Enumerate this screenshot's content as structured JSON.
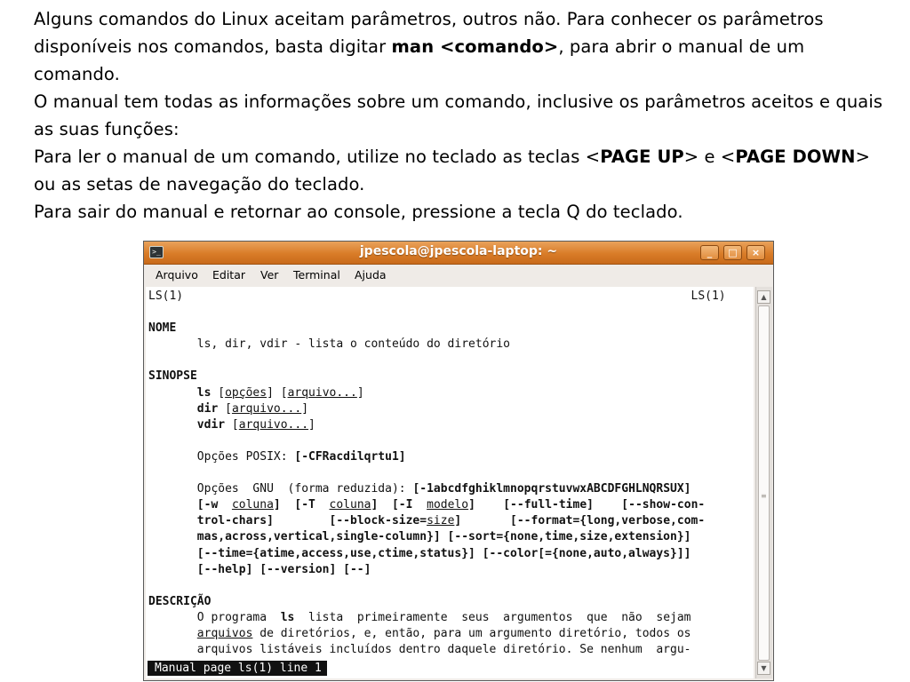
{
  "intro": {
    "p1_a": "Alguns comandos do Linux aceitam parâmetros, outros não. Para conhecer os parâmetros disponíveis nos comandos, basta digitar ",
    "p1_b": "man <comando>",
    "p1_c": ", para abrir o manual de um comando.",
    "p2": "O manual tem todas as informações sobre um comando, inclusive os parâmetros aceitos e quais as suas funções:",
    "p3_a": "Para ler o manual de um comando, utilize no teclado as teclas <",
    "p3_b": "PAGE UP",
    "p3_c": "> e <",
    "p3_d": "PAGE DOWN",
    "p3_e": "> ou as setas de navegação do teclado.",
    "p4": "Para sair do manual e retornar ao console, pressione a tecla Q do teclado."
  },
  "window": {
    "title": "jpescola@jpescola-laptop: ~",
    "terminal_icon": "terminal-icon",
    "minimize_glyph": "_",
    "maximize_glyph": "□",
    "close_glyph": "×",
    "accent_color": "#d97c28"
  },
  "menu": {
    "items": [
      "Arquivo",
      "Editar",
      "Ver",
      "Terminal",
      "Ajuda"
    ]
  },
  "terminal": {
    "header_left": "LS(1)",
    "header_right": "LS(1)",
    "sec_nome": "NOME",
    "nome_text": "ls, dir, vdir - lista o conteúdo do diretório",
    "sec_sinopse": "SINOPSE",
    "syn_ls_cmd": "ls",
    "syn_opcoes": "opções",
    "syn_arquivo": "arquivo...",
    "syn_dir_cmd": "dir",
    "syn_vdir_cmd": "vdir",
    "posix_label": "Opções POSIX: ",
    "posix_opts": "[-CFRacdilqrtu1]",
    "gnu_label": "Opções  GNU  (forma reduzida): ",
    "gnu_line1": "[-1abcdfghiklmnopqrstuvwxABCDFGHLNQRSUX]",
    "w_opt": "[-w  ",
    "coluna": "coluna",
    "t_opt": "[-T  ",
    "i_opt": "[-I  ",
    "modelo": "modelo",
    "full_time": "[--full-time]",
    "show_con": "[--show-con-",
    "trol_chars": "trol-chars]",
    "block_size": "[--block-size=",
    "size_word": "size",
    "format_opt": "[--format={long,verbose,com-",
    "gnu_line4": "mas,across,vertical,single-column}] [--sort={none,time,size,extension}]",
    "gnu_line5": "[--time={atime,access,use,ctime,status}] [--color[={none,auto,always}]]",
    "gnu_line6": "[--help] [--version] [--]",
    "sec_descricao": "DESCRIÇÃO",
    "desc1_a": "O programa  ",
    "desc1_ls": "ls",
    "desc1_b": "  lista  primeiramente  seus  argumentos  que  não  sejam",
    "desc2_arquivos": "arquivos",
    "desc2_b": " de diretórios, e, então, para um argumento diretório, todos os",
    "desc3": "arquivos listáveis incluídos dentro daquele diretório. Se nenhum  argu-",
    "status": "Manual page ls(1) line 1"
  }
}
